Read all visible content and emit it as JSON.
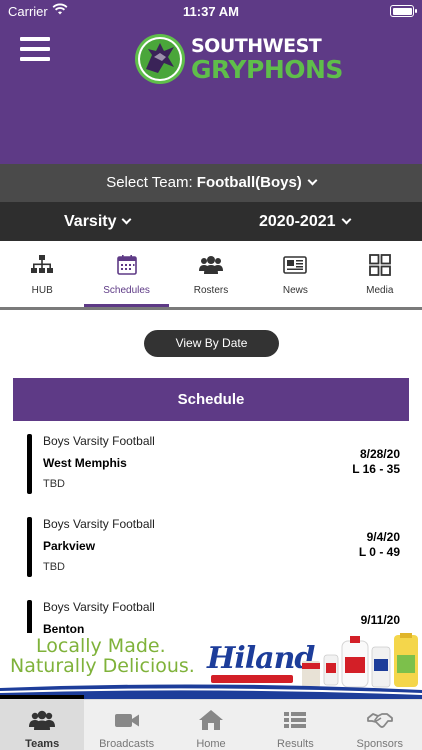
{
  "status_bar": {
    "carrier": "Carrier",
    "time": "11:37 AM"
  },
  "brand": {
    "line1": "SOUTHWEST",
    "line2": "GRYPHONS"
  },
  "team_select": {
    "prefix": "Select Team:",
    "team": "Football(Boys)"
  },
  "level_select": {
    "level": "Varsity",
    "season": "2020-2021"
  },
  "tabs": [
    {
      "label": "HUB",
      "icon": "hierarchy-icon"
    },
    {
      "label": "Schedules",
      "icon": "calendar-icon",
      "active": true
    },
    {
      "label": "Rosters",
      "icon": "people-icon"
    },
    {
      "label": "News",
      "icon": "newspaper-icon"
    },
    {
      "label": "Media",
      "icon": "grid-icon"
    }
  ],
  "view_button": "View By Date",
  "schedule": {
    "header": "Schedule",
    "games": [
      {
        "title": "Boys Varsity Football",
        "opponent": "West Memphis",
        "location": "TBD",
        "date": "8/28/20",
        "result": "L 16 - 35"
      },
      {
        "title": "Boys Varsity Football",
        "opponent": "Parkview",
        "location": "TBD",
        "date": "9/4/20",
        "result": "L 0 - 49"
      },
      {
        "title": "Boys Varsity Football",
        "opponent": "Benton",
        "location": "",
        "date": "9/11/20",
        "result": ""
      }
    ]
  },
  "ad": {
    "line1": "Locally Made.",
    "line2": "Naturally Delicious.",
    "brand": "Hiland"
  },
  "bottom_nav": [
    {
      "label": "Teams",
      "icon": "team-icon",
      "active": true
    },
    {
      "label": "Broadcasts",
      "icon": "video-camera-icon"
    },
    {
      "label": "Home",
      "icon": "home-icon"
    },
    {
      "label": "Results",
      "icon": "list-icon"
    },
    {
      "label": "Sponsors",
      "icon": "handshake-icon"
    }
  ],
  "colors": {
    "purple": "#5e3a86",
    "green": "#5fbe4a",
    "dark_gray": "#2e2e2e",
    "mid_gray": "#4a4a4a"
  }
}
